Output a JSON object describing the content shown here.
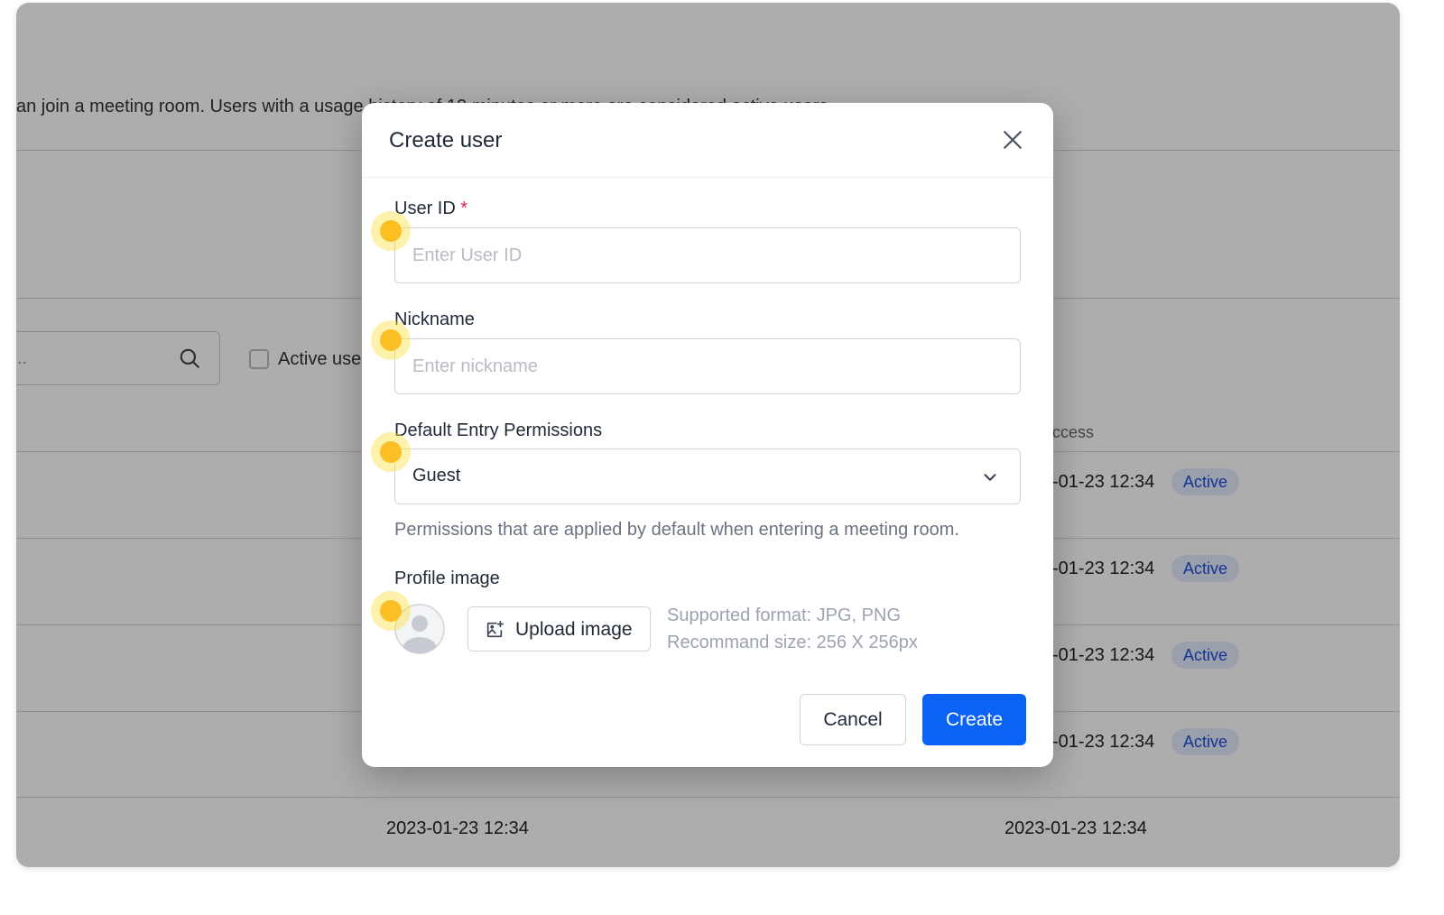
{
  "background": {
    "description": "an join a meeting room. Users with a usage history of 10 minutes or more are considered active users.",
    "search": {
      "placeholder_fragment": ".."
    },
    "filter_checkbox_label": "Active use",
    "column_header_fragment": "ccess",
    "rows": [
      {
        "date_fragment": "-01-23 12:34",
        "status": "Active"
      },
      {
        "date_fragment": "-01-23 12:34",
        "status": "Active"
      },
      {
        "date_fragment": "-01-23 12:34",
        "status": "Active"
      },
      {
        "date_fragment": "-01-23 12:34",
        "status": "Active"
      }
    ],
    "last_row": {
      "created": "2023-01-23 12:34",
      "last_access": "2023-01-23 12:34"
    }
  },
  "modal": {
    "title": "Create user",
    "close_icon": "close-icon",
    "user_id": {
      "label": "User ID",
      "required_mark": "*",
      "placeholder": "Enter User ID",
      "value": ""
    },
    "nickname": {
      "label": "Nickname",
      "placeholder": "Enter nickname",
      "value": ""
    },
    "permissions": {
      "label": "Default Entry Permissions",
      "selected": "Guest",
      "help": "Permissions that are applied by default when entering a meeting room."
    },
    "profile_image": {
      "label": "Profile image",
      "upload_label": "Upload image",
      "format_hint": "Supported format: JPG, PNG",
      "size_hint": "Recommand size: 256 X 256px"
    },
    "cancel_label": "Cancel",
    "create_label": "Create"
  },
  "colors": {
    "primary": "#0b63f6",
    "badge_bg": "#e3ecfd",
    "badge_text": "#1d4ed8",
    "required": "#e11d48",
    "marker": "#fbbf24"
  }
}
